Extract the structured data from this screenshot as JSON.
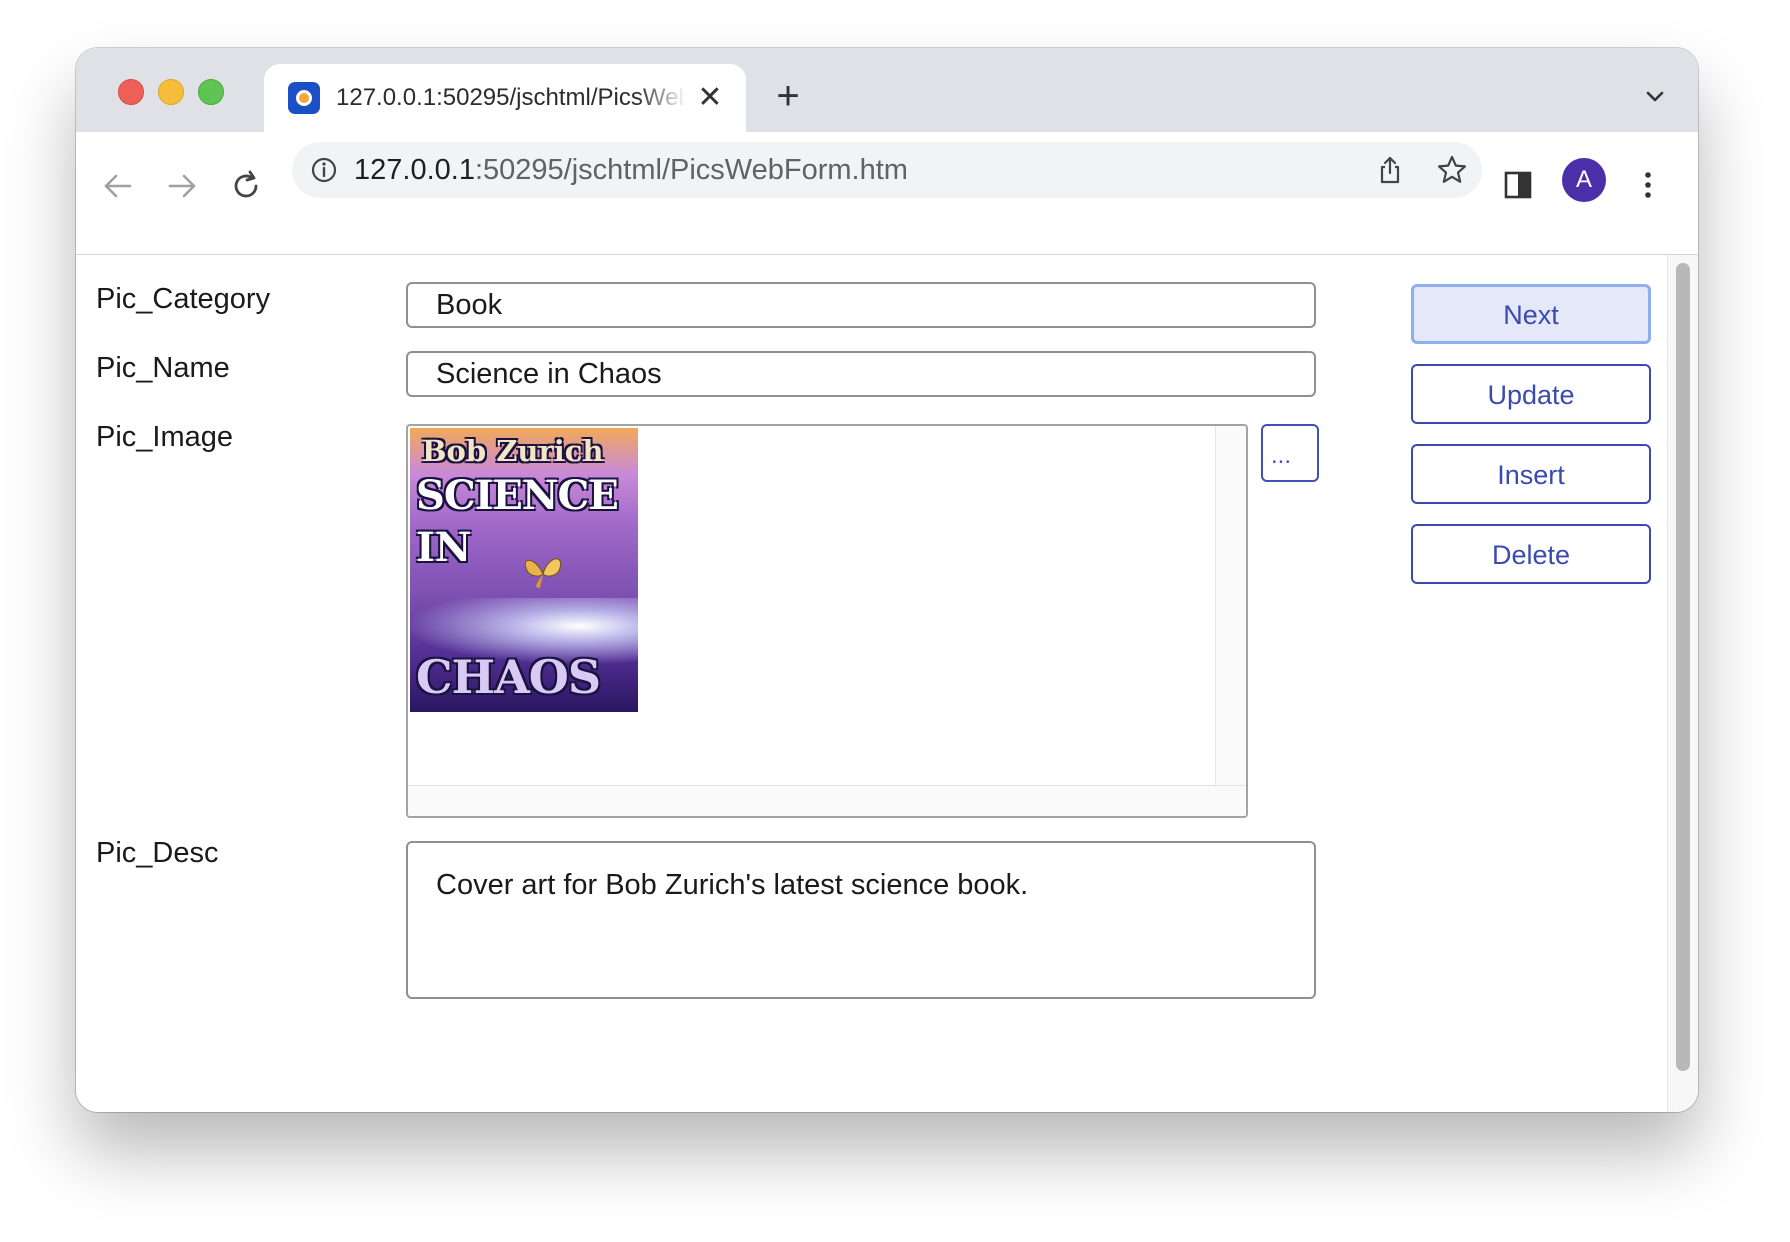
{
  "browser": {
    "tab_title": "127.0.0.1:50295/jschtml/PicsWebForm.htm",
    "url_host": "127.0.0.1",
    "url_path": ":50295/jschtml/PicsWebForm.htm",
    "profile_initial": "A",
    "accent_color": "#4a2fa8"
  },
  "form": {
    "category_label": "Pic_Category",
    "category_value": "Book",
    "name_label": "Pic_Name",
    "name_value": "Science in Chaos",
    "image_label": "Pic_Image",
    "browse_label": "...",
    "desc_label": "Pic_Desc",
    "desc_value": "Cover art for Bob Zurich's latest science book.",
    "cover": {
      "author": "Bob Zurich",
      "line1": "SCIENCE",
      "line2": "IN",
      "line3": "CHAOS"
    }
  },
  "actions": {
    "next_label": "Next",
    "update_label": "Update",
    "insert_label": "Insert",
    "delete_label": "Delete",
    "button_color": "#3a4bb0"
  },
  "icons": [
    "back-arrow-icon",
    "forward-arrow-icon",
    "reload-icon",
    "info-icon",
    "share-icon",
    "star-icon",
    "side-panel-icon",
    "kebab-menu-icon",
    "close-icon",
    "plus-icon",
    "chevron-down-icon"
  ]
}
